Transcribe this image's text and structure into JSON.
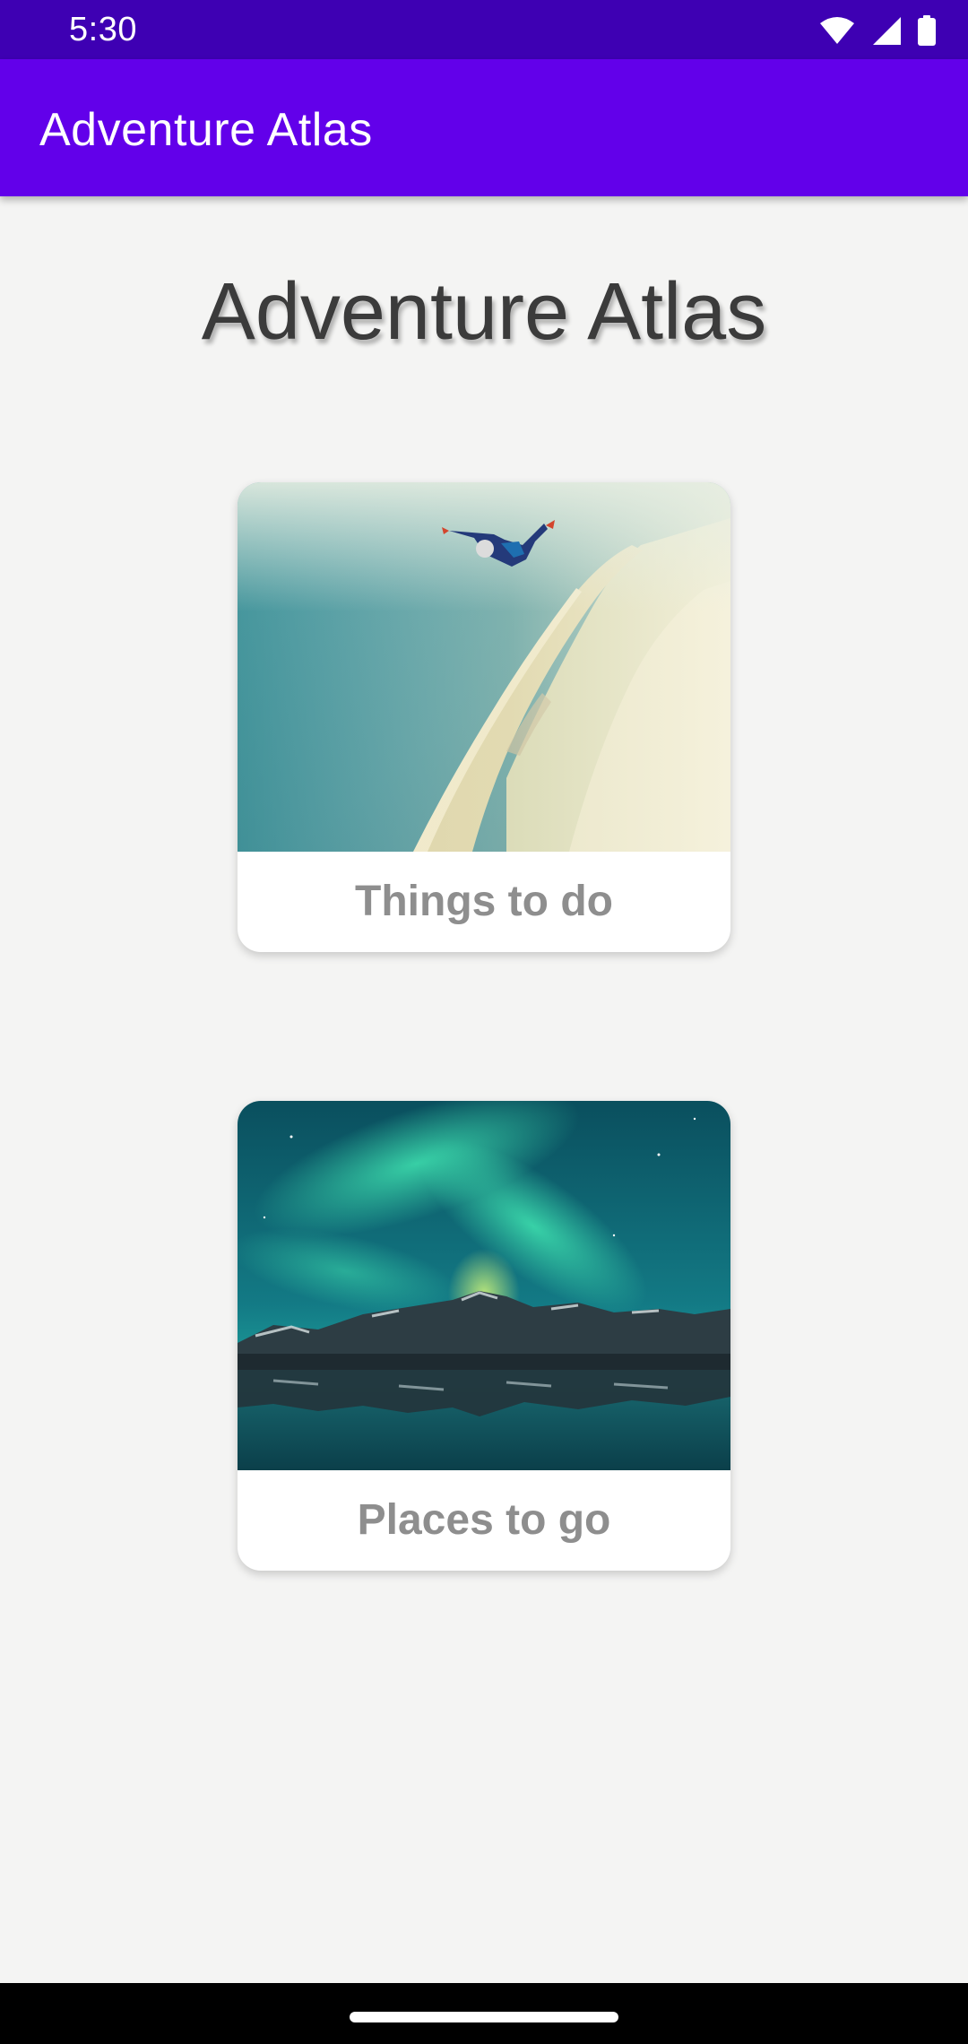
{
  "status_bar": {
    "time": "5:30",
    "icons": [
      "wifi-icon",
      "cellular-signal-icon",
      "battery-icon"
    ],
    "background": "#3e00b3"
  },
  "app_bar": {
    "title": "Adventure Atlas",
    "background": "#6200ea"
  },
  "main": {
    "heading": "Adventure Atlas",
    "cards": [
      {
        "label": "Things to do",
        "image": "skydiver-over-coastline"
      },
      {
        "label": "Places to go",
        "image": "aurora-over-mountains"
      }
    ]
  },
  "colors": {
    "page_background": "#f4f4f3",
    "card_label": "#8e8e8e",
    "heading": "#3b3b3b"
  }
}
